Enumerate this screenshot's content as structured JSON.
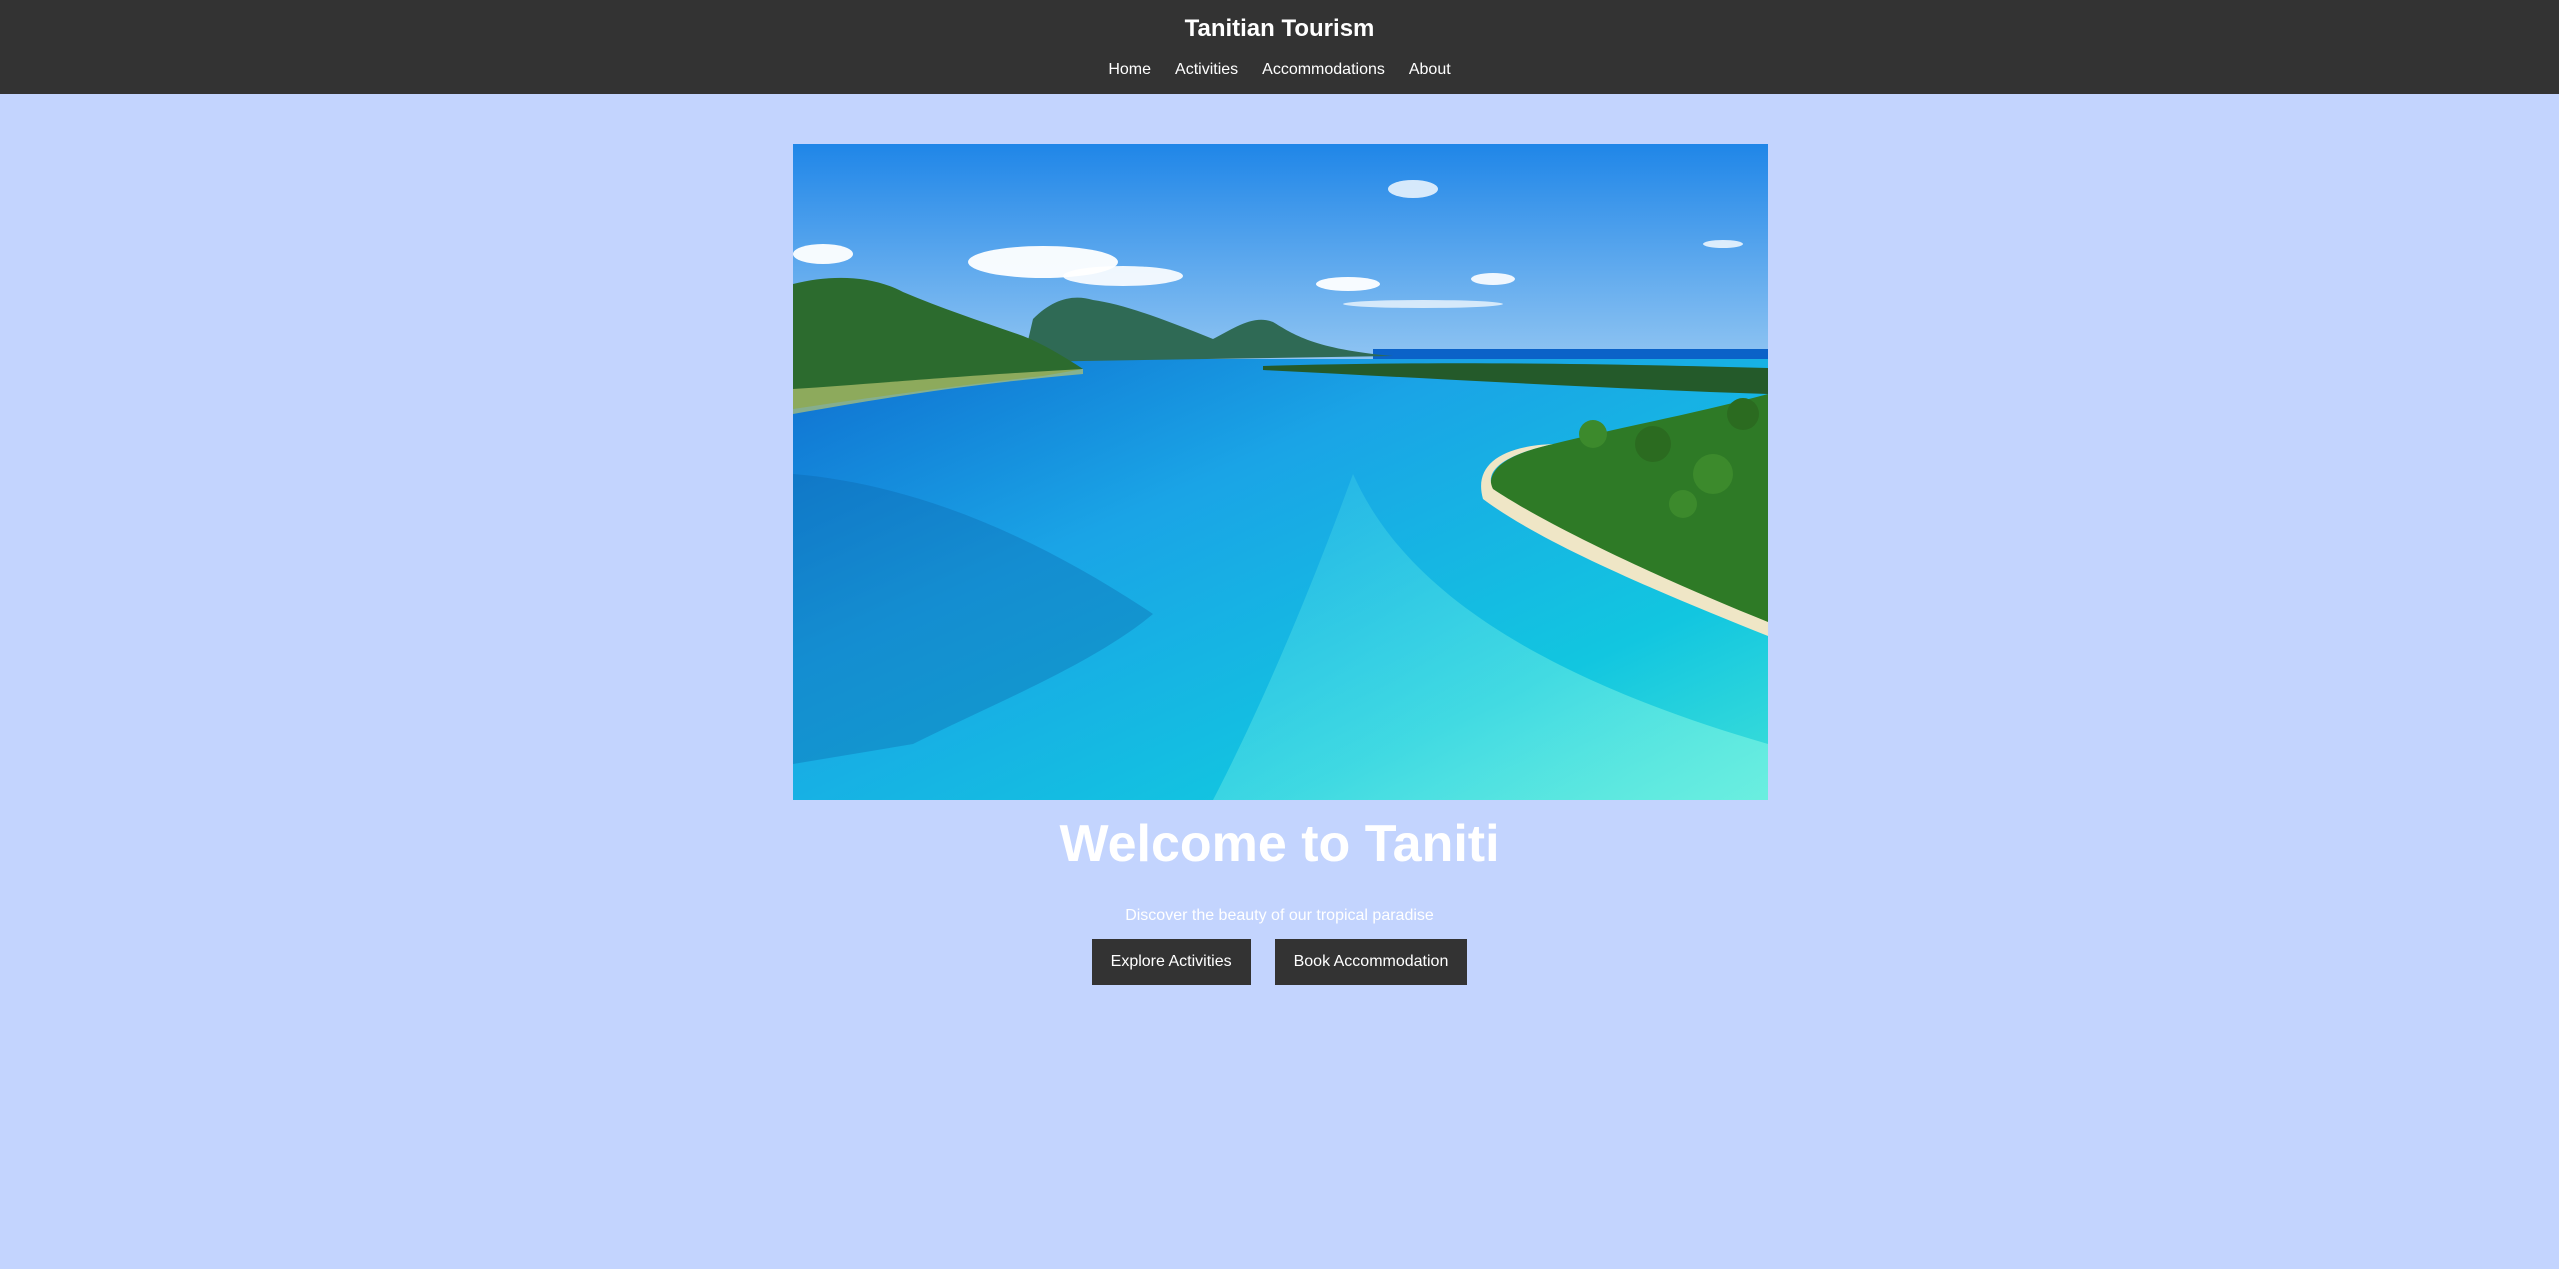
{
  "header": {
    "title": "Tanitian Tourism",
    "nav": [
      {
        "label": "Home"
      },
      {
        "label": "Activities"
      },
      {
        "label": "Accommodations"
      },
      {
        "label": "About"
      }
    ]
  },
  "hero": {
    "image_description": "tropical-lagoon-photo",
    "title": "Welcome to Taniti",
    "subtitle": "Discover the beauty of our tropical paradise",
    "buttons": [
      {
        "label": "Explore Activities"
      },
      {
        "label": "Book Accommodation"
      }
    ]
  },
  "colors": {
    "background": "#c3d4fe",
    "header": "#333333",
    "button": "#333333",
    "text_light": "#ffffff"
  }
}
